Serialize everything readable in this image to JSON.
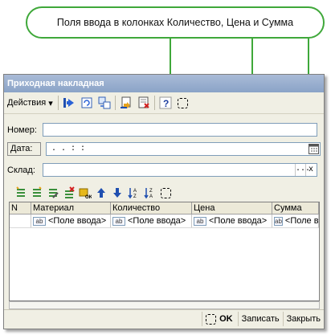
{
  "callout": {
    "text": "Поля ввода в колонках Количество, Цена и Сумма"
  },
  "window": {
    "title": "Приходная накладная"
  },
  "toolbar": {
    "actions_label": "Действия",
    "actions_underline": "Д",
    "actions_rest": "ействия"
  },
  "fields": {
    "number_label": "Номер:",
    "number_value": "",
    "date_label": "Дата:",
    "date_value": ". .     : :",
    "warehouse_label": "Склад:",
    "warehouse_value": "",
    "dots_button": "...",
    "clear_button": "x"
  },
  "table": {
    "columns": [
      "N",
      "Материал",
      "Количество",
      "Цена",
      "Сумма"
    ],
    "row": {
      "n": "",
      "material": "<Поле ввода>",
      "quantity": "<Поле ввода>",
      "price": "<Поле ввода>",
      "sum": "<Поле ввода>"
    },
    "field_icon_text": "ab"
  },
  "footer": {
    "ok_label": "OK",
    "save_label": "Записать",
    "close_label": "Закрыть"
  },
  "colors": {
    "callout_border": "#3fa83a",
    "title_bar": "#8aa3c7"
  }
}
